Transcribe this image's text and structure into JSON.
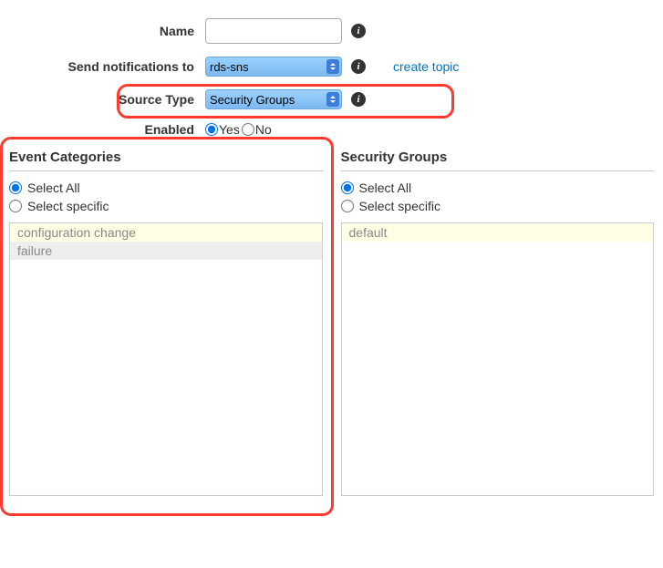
{
  "form": {
    "name": {
      "label": "Name",
      "value": ""
    },
    "send_to": {
      "label": "Send notifications to",
      "selected": "rds-sns"
    },
    "create_topic_link": "create topic",
    "source_type": {
      "label": "Source Type",
      "selected": "Security Groups"
    },
    "enabled": {
      "label": "Enabled",
      "yes": "Yes",
      "no": "No",
      "selected": "yes"
    }
  },
  "event_categories": {
    "title": "Event Categories",
    "select_all": "Select All",
    "select_specific": "Select specific",
    "selected_mode": "all",
    "items": [
      "configuration change",
      "failure"
    ]
  },
  "security_groups": {
    "title": "Security Groups",
    "select_all": "Select All",
    "select_specific": "Select specific",
    "selected_mode": "all",
    "items": [
      "default"
    ]
  }
}
